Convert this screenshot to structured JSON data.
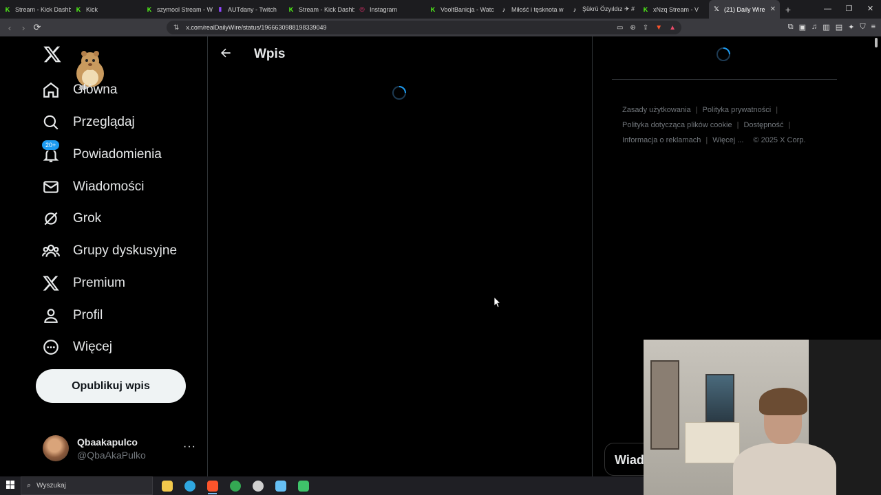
{
  "browser": {
    "tabs": [
      {
        "label": "Stream - Kick Dashb",
        "icon": "kick-icon",
        "color": "#53fc18"
      },
      {
        "label": "Kick",
        "icon": "kick-icon",
        "color": "#53fc18"
      },
      {
        "label": "szymool Stream - W",
        "icon": "kick-icon",
        "color": "#53fc18"
      },
      {
        "label": "AUTdany - Twitch",
        "icon": "twitch-icon",
        "color": "#9146ff"
      },
      {
        "label": "Stream - Kick Dashb",
        "icon": "kick-icon",
        "color": "#53fc18"
      },
      {
        "label": "Instagram",
        "icon": "instagram-icon",
        "color": "#e1306c"
      },
      {
        "label": "VooltBanicja - Watc",
        "icon": "kick-icon",
        "color": "#53fc18"
      },
      {
        "label": "Miłość i tęsknota w",
        "icon": "tiktok-icon",
        "color": "#ffffff"
      },
      {
        "label": "Şükrü Özyıldız ✈ #",
        "icon": "tiktok-icon",
        "color": "#ffffff"
      },
      {
        "label": "xNzq Stream - V",
        "icon": "kick-icon",
        "color": "#53fc18"
      },
      {
        "label": "(21) Daily Wire",
        "icon": "x-icon",
        "color": "#ffffff",
        "active": true
      }
    ],
    "url": "x.com/realDailyWire/status/1966630988198339049"
  },
  "sidebar": {
    "nav": [
      {
        "label": "Główna",
        "icon": "home-icon"
      },
      {
        "label": "Przeglądaj",
        "icon": "search-icon"
      },
      {
        "label": "Powiadomienia",
        "icon": "bell-icon",
        "badge": "20+"
      },
      {
        "label": "Wiadomości",
        "icon": "mail-icon"
      },
      {
        "label": "Grok",
        "icon": "grok-icon"
      },
      {
        "label": "Grupy dyskusyjne",
        "icon": "communities-icon"
      },
      {
        "label": "Premium",
        "icon": "x-icon"
      },
      {
        "label": "Profil",
        "icon": "profile-icon"
      },
      {
        "label": "Więcej",
        "icon": "more-circle-icon"
      }
    ],
    "post_button": "Opublikuj wpis",
    "account": {
      "name": "Qbaakapulco",
      "handle": "@QbaAkaPulko",
      "more": "···"
    }
  },
  "main": {
    "title": "Wpis"
  },
  "right": {
    "footer_links": [
      "Zasady użytkowania",
      "Polityka prywatności",
      "Polityka dotycząca plików cookie",
      "Dostępność",
      "Informacja o reklamach",
      "Więcej ..."
    ],
    "copyright": "© 2025 X Corp."
  },
  "overlay": {
    "partial_label": "Wiadc"
  },
  "taskbar": {
    "search_placeholder": "Wyszukaj",
    "apps": [
      {
        "icon": "file-explorer-icon",
        "color": "#f2c94c"
      },
      {
        "icon": "edge-icon",
        "color": "#2fa7e0"
      },
      {
        "icon": "brave-icon",
        "color": "#fb542b",
        "active": true
      },
      {
        "icon": "chrome-icon",
        "color": "#34a853"
      },
      {
        "icon": "obs-icon",
        "color": "#cfcfcf"
      },
      {
        "icon": "steam-icon",
        "color": "#66c0f4"
      },
      {
        "icon": "app-icon",
        "color": "#3fc36a"
      }
    ]
  }
}
